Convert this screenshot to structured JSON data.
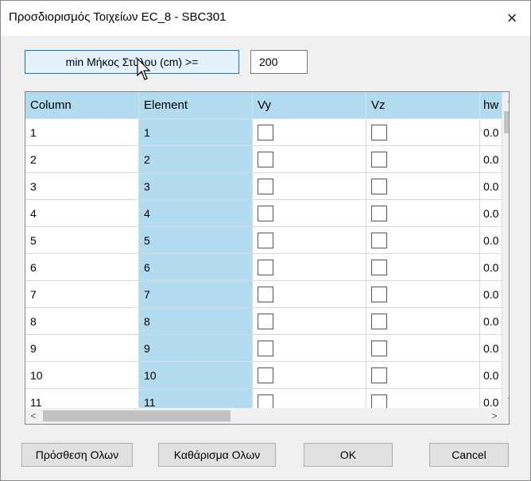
{
  "window": {
    "title": "Προσδιορισμός Τοιχείων EC_8 - SBC301",
    "close_icon": "×"
  },
  "filter": {
    "button_label": "min Μήκος Στύλου (cm) >=",
    "length_value": "200"
  },
  "grid": {
    "columns": [
      "Column",
      "Element",
      "Vy",
      "Vz",
      "hw"
    ],
    "rows": [
      {
        "column": "1",
        "element": "1",
        "hw": "0.0"
      },
      {
        "column": "2",
        "element": "2",
        "hw": "0.0"
      },
      {
        "column": "3",
        "element": "3",
        "hw": "0.0"
      },
      {
        "column": "4",
        "element": "4",
        "hw": "0.0"
      },
      {
        "column": "5",
        "element": "5",
        "hw": "0.0"
      },
      {
        "column": "6",
        "element": "6",
        "hw": "0.0"
      },
      {
        "column": "7",
        "element": "7",
        "hw": "0.0"
      },
      {
        "column": "8",
        "element": "8",
        "hw": "0.0"
      },
      {
        "column": "9",
        "element": "9",
        "hw": "0.0"
      },
      {
        "column": "10",
        "element": "10",
        "hw": "0.0"
      },
      {
        "column": "11",
        "element": "11",
        "hw": "0.0"
      }
    ]
  },
  "scroll": {
    "up": "˄",
    "down": "˅",
    "left": "<",
    "right": ">"
  },
  "buttons": {
    "add_all": "Πρόσθεση Ολων",
    "clear_all": "Καθάρισμα Ολων",
    "ok": "OK",
    "cancel": "Cancel"
  },
  "colors": {
    "accent": "#0078d7",
    "selected_column": "#b3dbef"
  }
}
